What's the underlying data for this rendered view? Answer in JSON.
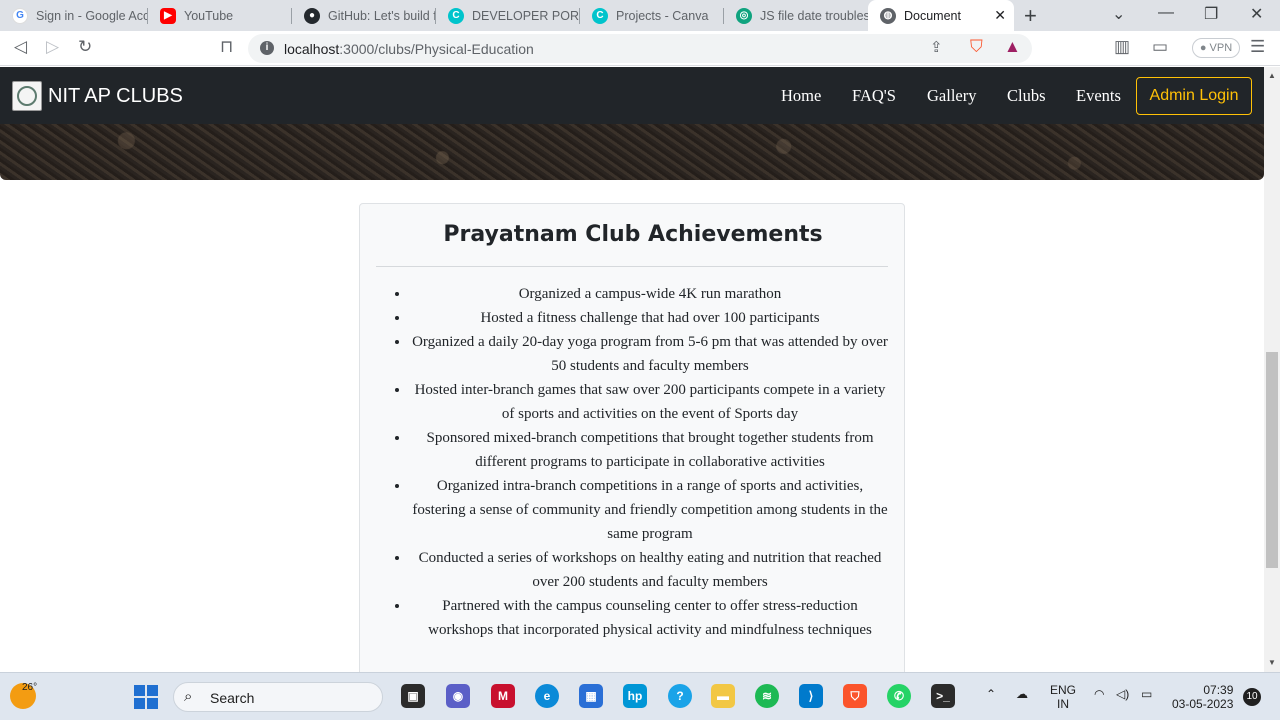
{
  "browser": {
    "tabs": [
      {
        "title": "Sign in - Google Acc",
        "icon": "google-icon",
        "color": "#4285f4"
      },
      {
        "title": "YouTube",
        "icon": "youtube-icon",
        "color": "#ff0000"
      },
      {
        "title": "GitHub: Let's build f",
        "icon": "github-icon",
        "color": "#24292e"
      },
      {
        "title": "DEVELOPER PORTFC",
        "icon": "canva-icon",
        "color": "#00c4cc"
      },
      {
        "title": "Projects - Canva",
        "icon": "canva-icon",
        "color": "#00c4cc"
      },
      {
        "title": "JS file date troublesl",
        "icon": "chatgpt-icon",
        "color": "#10a37f"
      },
      {
        "title": "Document",
        "icon": "globe-icon",
        "color": "#5f6368"
      }
    ],
    "active_tab": 6,
    "url_host": "localhost",
    "url_path": ":3000/clubs/Physical-Education",
    "vpn_label": "VPN"
  },
  "navbar": {
    "brand": "NIT AP CLUBS",
    "links": [
      "Home",
      "FAQ'S",
      "Gallery",
      "Clubs",
      "Events"
    ],
    "admin_label": "Admin Login",
    "accent": "#ffc107"
  },
  "achievements": {
    "title": "Prayatnam Club Achievements",
    "items": [
      "Organized a campus-wide 4K run marathon",
      "Hosted a fitness challenge that had over 100 participants",
      "Organized a daily 20-day yoga program from 5-6 pm that was attended by over 50 students and faculty members",
      "Hosted inter-branch games that saw over 200 participants compete in a variety of sports and activities on the event of Sports day",
      "Sponsored mixed-branch competitions that brought together students from different programs to participate in collaborative activities",
      "Organized intra-branch competitions in a range of sports and activities, fostering a sense of community and friendly competition among students in the same program",
      "Conducted a series of workshops on healthy eating and nutrition that reached over 200 students and faculty members",
      "Partnered with the campus counseling center to offer stress-reduction workshops that incorporated physical activity and mindfulness techniques"
    ]
  },
  "taskbar": {
    "temperature": "26°",
    "search_label": "Search",
    "language": "ENG",
    "region": "IN",
    "time": "07:39",
    "date": "03-05-2023",
    "notifications": "10"
  }
}
